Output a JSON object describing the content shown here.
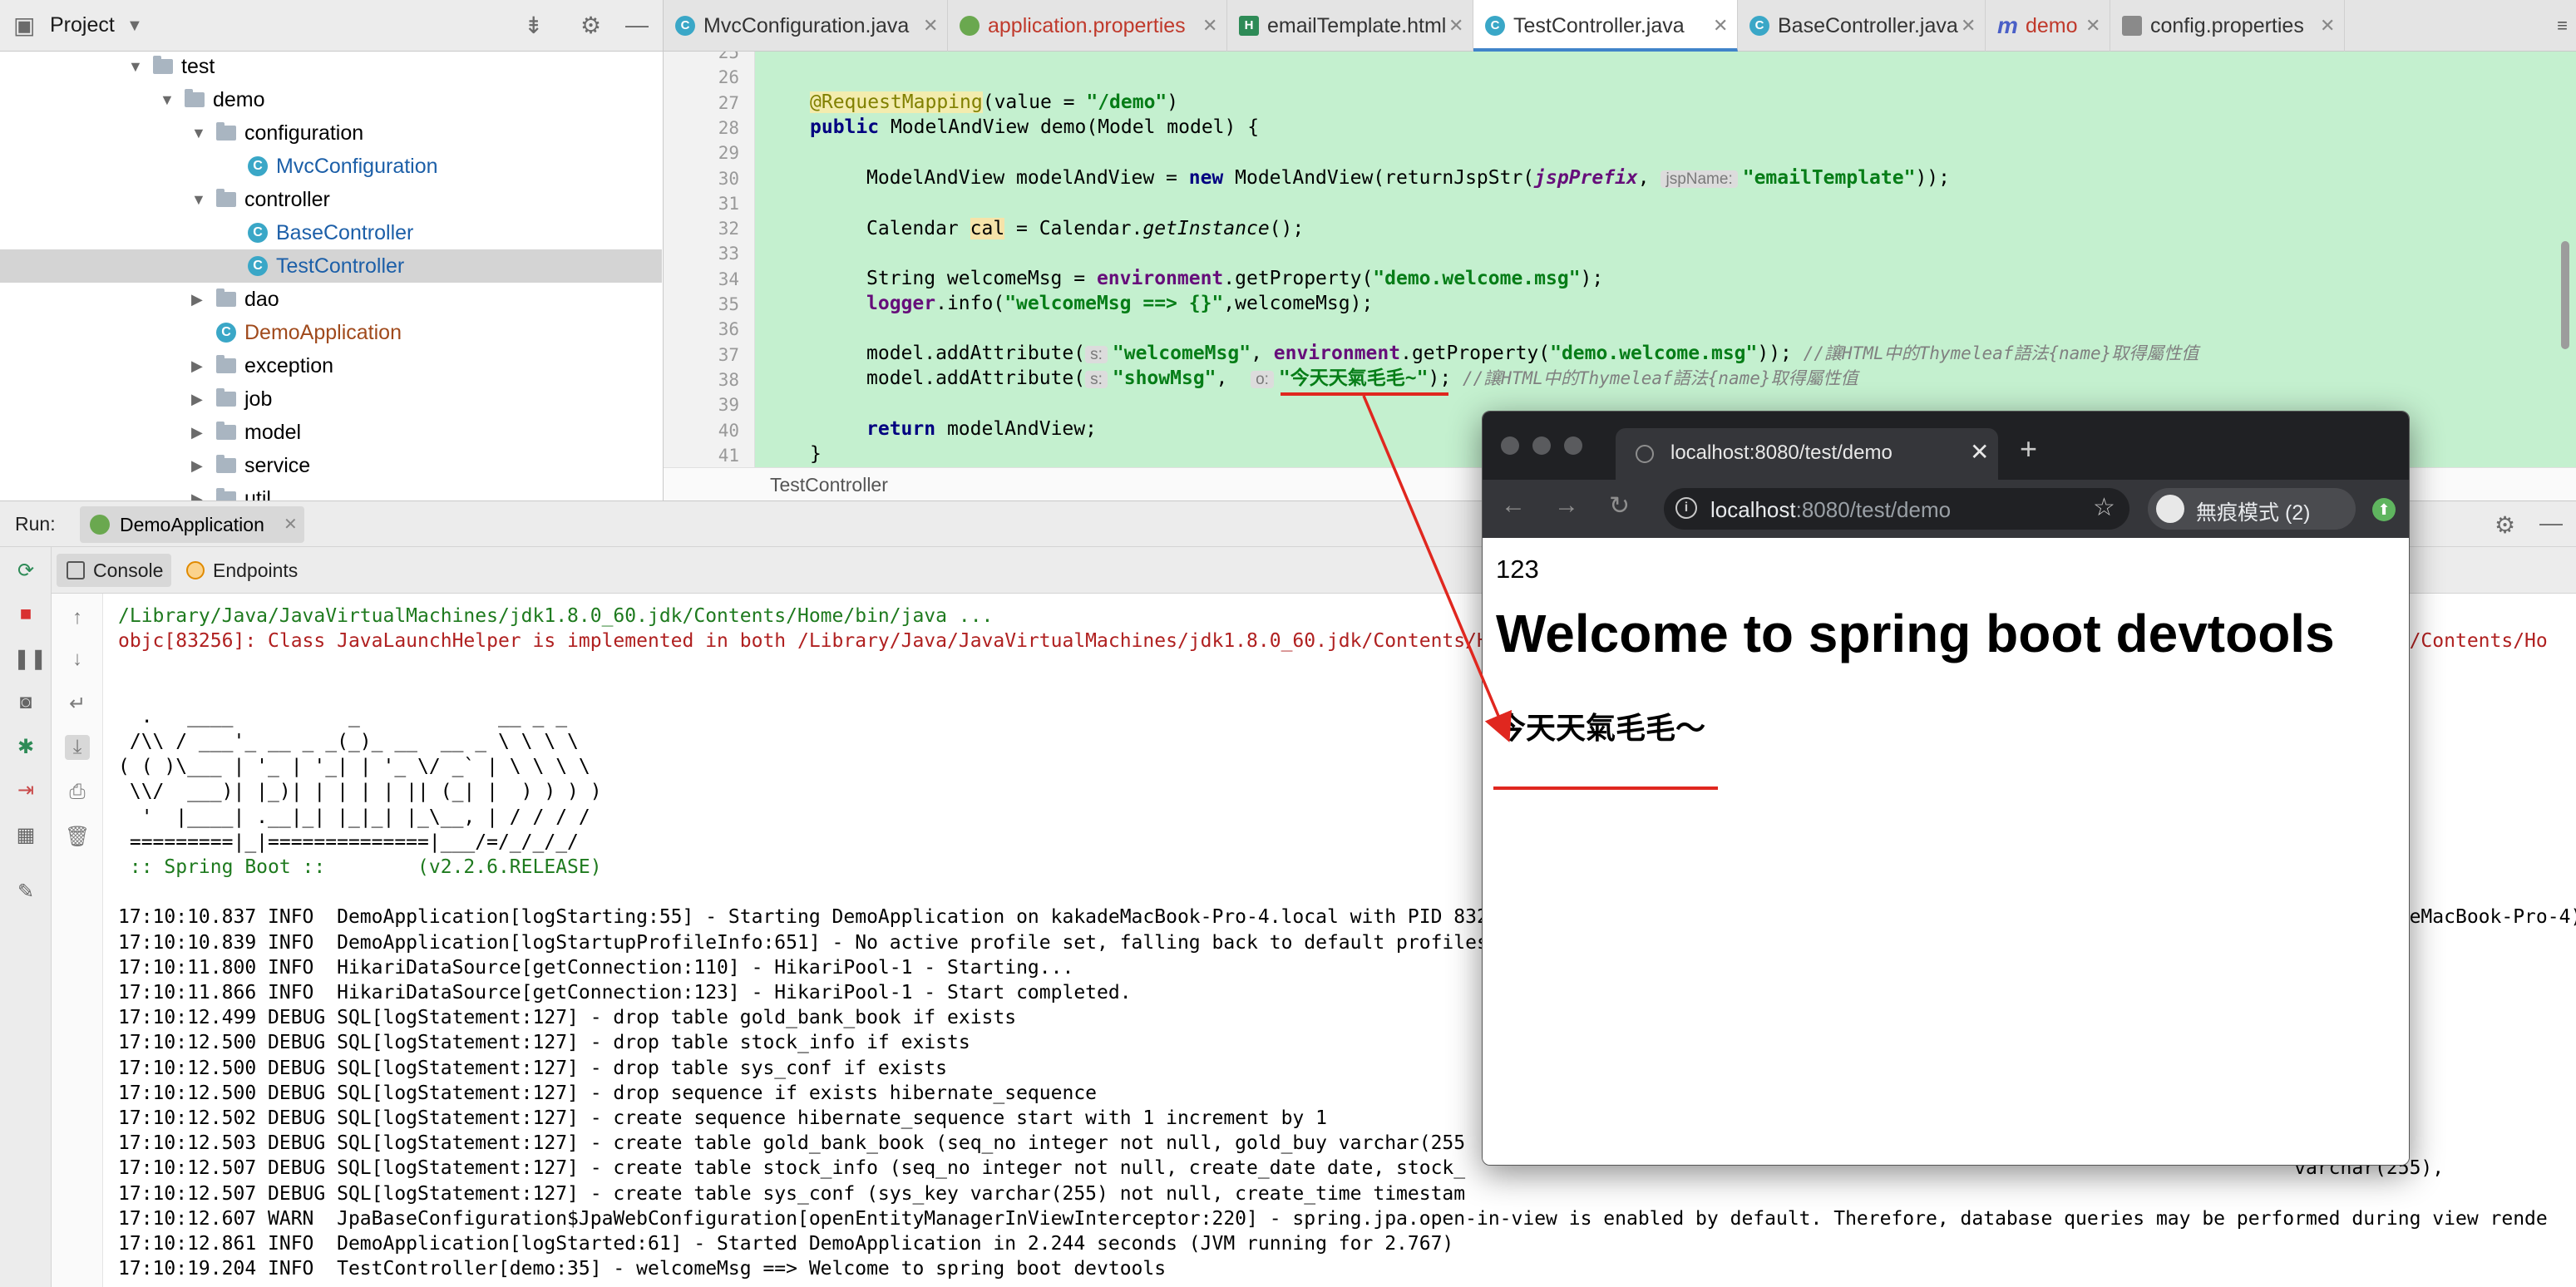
{
  "project": {
    "title": "Project",
    "tree": [
      {
        "label": "test",
        "kind": "folder",
        "depth": 0,
        "expanded": true
      },
      {
        "label": "demo",
        "kind": "folder",
        "depth": 1,
        "expanded": true
      },
      {
        "label": "configuration",
        "kind": "folder",
        "depth": 2,
        "expanded": true
      },
      {
        "label": "MvcConfiguration",
        "kind": "class",
        "depth": 3
      },
      {
        "label": "controller",
        "kind": "folder",
        "depth": 2,
        "expanded": true
      },
      {
        "label": "BaseController",
        "kind": "class",
        "depth": 3
      },
      {
        "label": "TestController",
        "kind": "class",
        "depth": 3,
        "selected": true
      },
      {
        "label": "dao",
        "kind": "folder",
        "depth": 2,
        "expanded": false
      },
      {
        "label": "DemoApplication",
        "kind": "boot",
        "depth": 2
      },
      {
        "label": "exception",
        "kind": "folder",
        "depth": 2,
        "expanded": false
      },
      {
        "label": "job",
        "kind": "folder",
        "depth": 2,
        "expanded": false
      },
      {
        "label": "model",
        "kind": "folder",
        "depth": 2,
        "expanded": false
      },
      {
        "label": "service",
        "kind": "folder",
        "depth": 2,
        "expanded": false
      },
      {
        "label": "util",
        "kind": "folder",
        "depth": 2,
        "expanded": false
      }
    ]
  },
  "editor_tabs": [
    {
      "label": "MvcConfiguration.java",
      "icon": "class-icon",
      "glyph": "C"
    },
    {
      "label": "application.properties",
      "icon": "spring-leaf-icon",
      "glyph": "",
      "accent": "#c0392b"
    },
    {
      "label": "emailTemplate.html",
      "icon": "html-file-icon",
      "glyph": "H"
    },
    {
      "label": "TestController.java",
      "icon": "class-icon",
      "glyph": "C",
      "active": true
    },
    {
      "label": "BaseController.java",
      "icon": "class-icon",
      "glyph": "C"
    },
    {
      "label": "demo",
      "icon": "mapping-icon",
      "glyph": "m",
      "accent": "#c0392b"
    },
    {
      "label": "config.properties",
      "icon": "properties-file-icon",
      "glyph": ""
    }
  ],
  "editor": {
    "line_numbers": [
      "25",
      "26",
      "27",
      "28",
      "29",
      "30",
      "31",
      "32",
      "33",
      "34",
      "35",
      "36",
      "37",
      "38",
      "39",
      "40",
      "41"
    ],
    "breadcrumb": "TestController",
    "code": {
      "l27_ann": "@RequestMapping",
      "l27_rest": "(value = ",
      "l27_str": "\"/demo\"",
      "l27_end": ")",
      "l28_kw": "public",
      "l28_rest": " ModelAndView demo(Model model) {",
      "l30_a": "ModelAndView modelAndView = ",
      "l30_kw": "new",
      "l30_b": " ModelAndView(returnJspStr(",
      "l30_fld": "jspPrefix",
      "l30_c": ", ",
      "l30_hint": "jspName:",
      "l30_str": "\"emailTemplate\"",
      "l30_d": "));",
      "l32_a": "Calendar ",
      "l32_var": "cal",
      "l32_b": " = Calendar.",
      "l32_m": "getInstance",
      "l32_c": "();",
      "l34_a": "String welcomeMsg = ",
      "l34_fld": "environment",
      "l34_b": ".getProperty(",
      "l34_str": "\"demo.welcome.msg\"",
      "l34_c": ");",
      "l35_fld": "logger",
      "l35_a": ".info(",
      "l35_str": "\"welcomeMsg ==> {}\"",
      "l35_b": ",welcomeMsg);",
      "l37_a": "model.addAttribute(",
      "l37_hint": "s:",
      "l37_str": "\"welcomeMsg\"",
      "l37_b": ", ",
      "l37_fld": "environment",
      "l37_c": ".getProperty(",
      "l37_str2": "\"demo.welcome.msg\"",
      "l37_d": ")); ",
      "l37_cmt": "//讓HTML中的Thymeleaf語法{name}取得屬性值",
      "l38_a": "model.addAttribute(",
      "l38_hint": "s:",
      "l38_str": "\"showMsg\"",
      "l38_b": ",  ",
      "l38_hint2": "o:",
      "l38_str2": "\"今天天氣毛毛~\"",
      "l38_c": "); ",
      "l38_cmt": "//讓HTML中的Thymeleaf語法{name}取得屬性值",
      "l40_kw": "return",
      "l40_rest": " modelAndView;",
      "l41": "}"
    }
  },
  "run": {
    "label": "Run:",
    "tab": "DemoApplication",
    "console_tab": "Console",
    "endpoints_tab": "Endpoints",
    "output": [
      {
        "t": "/Library/Java/JavaVirtualMachines/jdk1.8.0_60.jdk/Contents/Home/bin/java ...",
        "c": "cmd"
      },
      {
        "t": "objc[83256]: Class JavaLaunchHelper is implemented in both /Library/Java/JavaVirtualMachines/jdk1.8.0_60.jdk/Contents/Home/bin/java (0x10d4c94c0) and /Library/Java/JavaVirtualMachines/jdk1.8.0_60.jdk/Contents/Ho",
        "c": "err"
      },
      {
        "t": "",
        "c": ""
      },
      {
        "t": "",
        "c": ""
      },
      {
        "t": "  .   ____          _            __ _ _",
        "c": "banner"
      },
      {
        "t": " /\\\\ / ___'_ __ _ _(_)_ __  __ _ \\ \\ \\ \\",
        "c": "banner"
      },
      {
        "t": "( ( )\\___ | '_ | '_| | '_ \\/ _` | \\ \\ \\ \\",
        "c": "banner"
      },
      {
        "t": " \\\\/  ___)| |_)| | | | | || (_| |  ) ) ) )",
        "c": "banner"
      },
      {
        "t": "  '  |____| .__|_| |_|_| |_\\__, | / / / /",
        "c": "banner"
      },
      {
        "t": " =========|_|==============|___/=/_/_/_/",
        "c": "banner"
      },
      {
        "t": " :: Spring Boot ::        (v2.2.6.RELEASE)",
        "c": "sb"
      },
      {
        "t": "",
        "c": ""
      },
      {
        "t": "17:10:10.837 INFO  DemoApplication[logStarting:55] - Starting DemoApplication on kakadeMacBook-Pro-4.local with PID 83256 (/Users/kakadeMacBook-Pro-4/IdeaProjects/test/target/classes started by kakadeMacBook-Pro-4)i in /Users/ka",
        "c": ""
      },
      {
        "t": "17:10:10.839 INFO  DemoApplication[logStartupProfileInfo:651] - No active profile set, falling back to default profiles: default",
        "c": ""
      },
      {
        "t": "17:10:11.800 INFO  HikariDataSource[getConnection:110] - HikariPool-1 - Starting...",
        "c": ""
      },
      {
        "t": "17:10:11.866 INFO  HikariDataSource[getConnection:123] - HikariPool-1 - Start completed.",
        "c": ""
      },
      {
        "t": "17:10:12.499 DEBUG SQL[logStatement:127] - drop table gold_bank_book if exists",
        "c": ""
      },
      {
        "t": "17:10:12.500 DEBUG SQL[logStatement:127] - drop table stock_info if exists",
        "c": ""
      },
      {
        "t": "17:10:12.500 DEBUG SQL[logStatement:127] - drop table sys_conf if exists",
        "c": ""
      },
      {
        "t": "17:10:12.500 DEBUG SQL[logStatement:127] - drop sequence if exists hibernate_sequence",
        "c": ""
      },
      {
        "t": "17:10:12.502 DEBUG SQL[logStatement:127] - create sequence hibernate_sequence start with 1 increment by 1",
        "c": ""
      },
      {
        "t": "17:10:12.503 DEBUG SQL[logStatement:127] - create table gold_bank_book (seq_no integer not null, gold_buy varchar(255",
        "c": ""
      },
      {
        "t": "17:10:12.507 DEBUG SQL[logStatement:127] - create table stock_info (seq_no integer not null, create_date date, stock_                                                                        varchar(255),",
        "c": ""
      },
      {
        "t": "17:10:12.507 DEBUG SQL[logStatement:127] - create table sys_conf (sys_key varchar(255) not null, create_time timestam",
        "c": ""
      },
      {
        "t": "17:10:12.607 WARN  JpaBaseConfiguration$JpaWebConfiguration[openEntityManagerInViewInterceptor:220] - spring.jpa.open-in-view is enabled by default. Therefore, database queries may be performed during view rende",
        "c": ""
      },
      {
        "t": "17:10:12.861 INFO  DemoApplication[logStarted:61] - Started DemoApplication in 2.244 seconds (JVM running for 2.767)",
        "c": ""
      },
      {
        "t": "17:10:19.204 INFO  TestController[demo:35] - welcomeMsg ==> Welcome to spring boot devtools",
        "c": ""
      }
    ]
  },
  "browser": {
    "tab_title": "localhost:8080/test/demo",
    "url_host": "localhost",
    "url_rest": ":8080/test/demo",
    "incognito_label": "無痕模式 (2)",
    "page": {
      "text": "123",
      "heading": "Welcome to spring boot devtools",
      "subheading": "今天天氣毛毛～"
    }
  },
  "colors": {
    "editor_highlight": "#c4f0cf",
    "annotation_red": "#e0271f",
    "selection": "#d4d4d4"
  }
}
